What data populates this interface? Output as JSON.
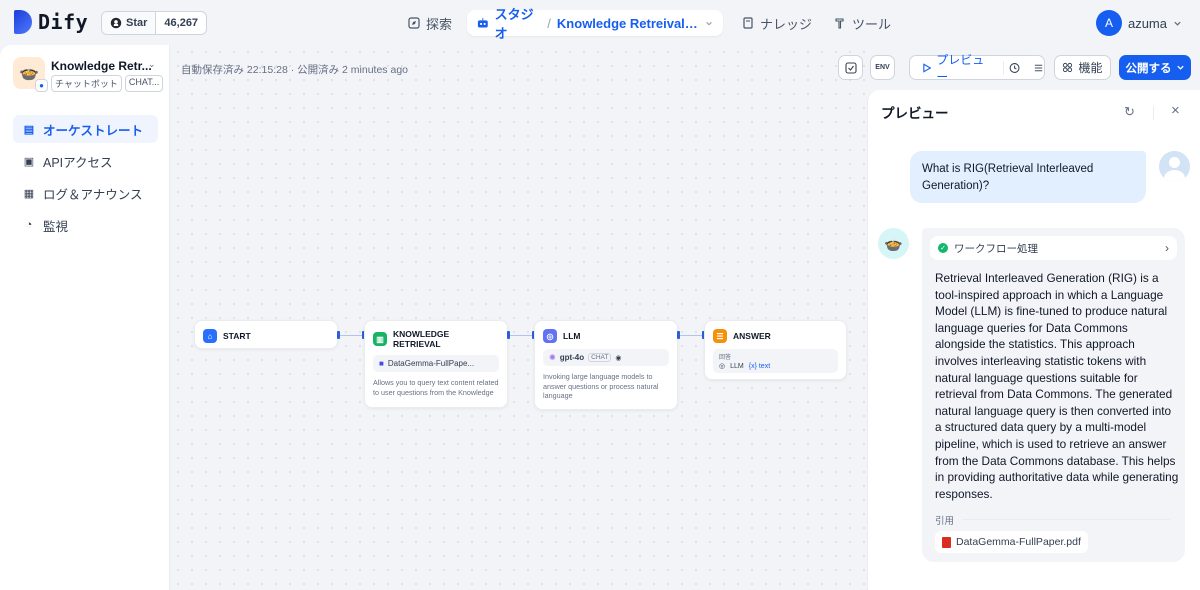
{
  "brand": {
    "name": "Dify"
  },
  "github": {
    "star_label": "Star",
    "star_count": "46,267"
  },
  "topnav": {
    "explore": "探索",
    "studio": "スタジオ",
    "app_name": "Knowledge Retreival + C...",
    "knowledge": "ナレッジ",
    "tools": "ツール"
  },
  "user": {
    "initial": "A",
    "name": "azuma"
  },
  "app": {
    "name": "Knowledge Retr...",
    "type_tag": "チャットボット",
    "mode_tag": "CHAT..."
  },
  "sidebar": {
    "items": [
      {
        "label": "オーケストレート",
        "icon": "orchestrate-icon",
        "active": true
      },
      {
        "label": "APIアクセス",
        "icon": "terminal-icon",
        "active": false
      },
      {
        "label": "ログ＆アナウンス",
        "icon": "document-icon",
        "active": false
      },
      {
        "label": "監視",
        "icon": "monitor-icon",
        "active": false
      }
    ]
  },
  "status": {
    "saved_text": "自動保存済み 22:15:28 · 公開済み 2 minutes ago"
  },
  "toolbar": {
    "env_label": "ENV",
    "preview_label": "プレビュー",
    "features_label": "機能",
    "publish_label": "公開する"
  },
  "workflow": {
    "nodes": [
      {
        "title": "START"
      },
      {
        "title": "KNOWLEDGE RETRIEVAL",
        "sub": "DataGemma-FullPape...",
        "desc": "Allows you to query text content related to user questions from the Knowledge"
      },
      {
        "title": "LLM",
        "model": "gpt-4o",
        "chip": "CHAT",
        "desc": "Invoking large language models to answer questions or process natural language"
      },
      {
        "title": "ANSWER",
        "field_label": "回答",
        "var_source": "LLM",
        "var_name": "{x} text"
      }
    ]
  },
  "preview": {
    "title": "プレビュー",
    "question": "What is RIG(Retrieval Interleaved Generation)?",
    "workflow_label": "ワークフロー処理",
    "answer": "Retrieval Interleaved Generation (RIG) is a tool-inspired approach in which a Language Model (LLM) is fine-tuned to produce natural language queries for Data Commons alongside the statistics. This approach involves interleaving statistic tokens with natural language questions suitable for retrieval from Data Commons. The generated natural language query is then converted into a structured data query by a multi-model pipeline, which is used to retrieve an answer from the Data Commons database. This helps in providing authoritative data while generating responses.",
    "citation_label": "引用",
    "citation_file": "DataGemma-FullPaper.pdf"
  },
  "colors": {
    "accent": "#155eef",
    "success": "#12b76a",
    "pdf": "#d92d20"
  }
}
